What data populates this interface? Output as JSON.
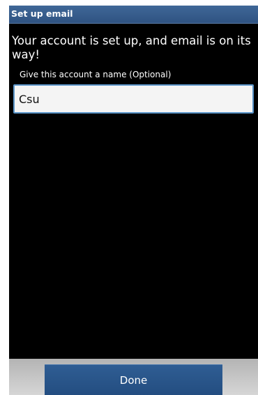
{
  "titlebar": {
    "title": "Set up email"
  },
  "main": {
    "message": "Your account is set up, and email is on its way!",
    "account_name_label": "Give this account a name (Optional)",
    "account_name_value": "Csu"
  },
  "footer": {
    "done_label": "Done"
  },
  "colors": {
    "titlebar": "#3a6090",
    "background": "#000000",
    "button": "#2a5588"
  }
}
